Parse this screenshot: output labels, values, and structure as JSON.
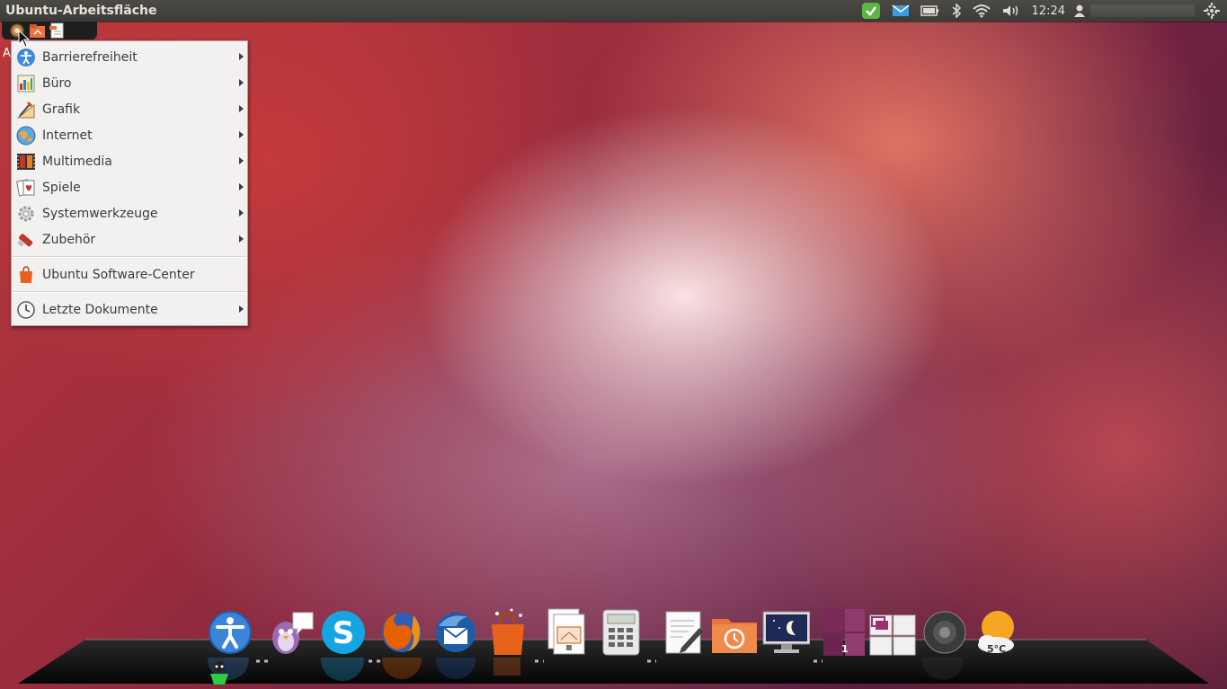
{
  "panel": {
    "title": "Ubuntu-Arbeitsfläche",
    "clock": "12:24"
  },
  "cursor_hidden_label": "A",
  "menu": {
    "items": [
      {
        "label": "Barrierefreiheit",
        "icon": "accessibility-icon",
        "submenu": true
      },
      {
        "label": "Büro",
        "icon": "office-icon",
        "submenu": true
      },
      {
        "label": "Grafik",
        "icon": "graphics-icon",
        "submenu": true
      },
      {
        "label": "Internet",
        "icon": "internet-globe-icon",
        "submenu": true
      },
      {
        "label": "Multimedia",
        "icon": "multimedia-icon",
        "submenu": true
      },
      {
        "label": "Spiele",
        "icon": "games-cards-icon",
        "submenu": true
      },
      {
        "label": "Systemwerkzeuge",
        "icon": "system-gear-icon",
        "submenu": true
      },
      {
        "label": "Zubehör",
        "icon": "accessories-icon",
        "submenu": true
      }
    ],
    "software_center": {
      "label": "Ubuntu Software-Center",
      "icon": "software-center-bag-icon"
    },
    "recent": {
      "label": "Letzte Dokumente",
      "icon": "recent-documents-icon",
      "submenu": true
    }
  },
  "dock": {
    "icons": [
      "accessibility-icon",
      "pidgin-icon",
      "skype-icon",
      "firefox-icon",
      "thunderbird-icon",
      "software-center-icon",
      "impress-presentation-icon",
      "calculator-icon",
      "text-editor-icon",
      "backup-folder-icon",
      "screensaver-monitor-icon",
      "workspace-switcher-icon",
      "window-picker-icon",
      "sound-speaker-icon",
      "weather-icon"
    ],
    "workspace_number": "1",
    "weather_temp": "5°C"
  }
}
